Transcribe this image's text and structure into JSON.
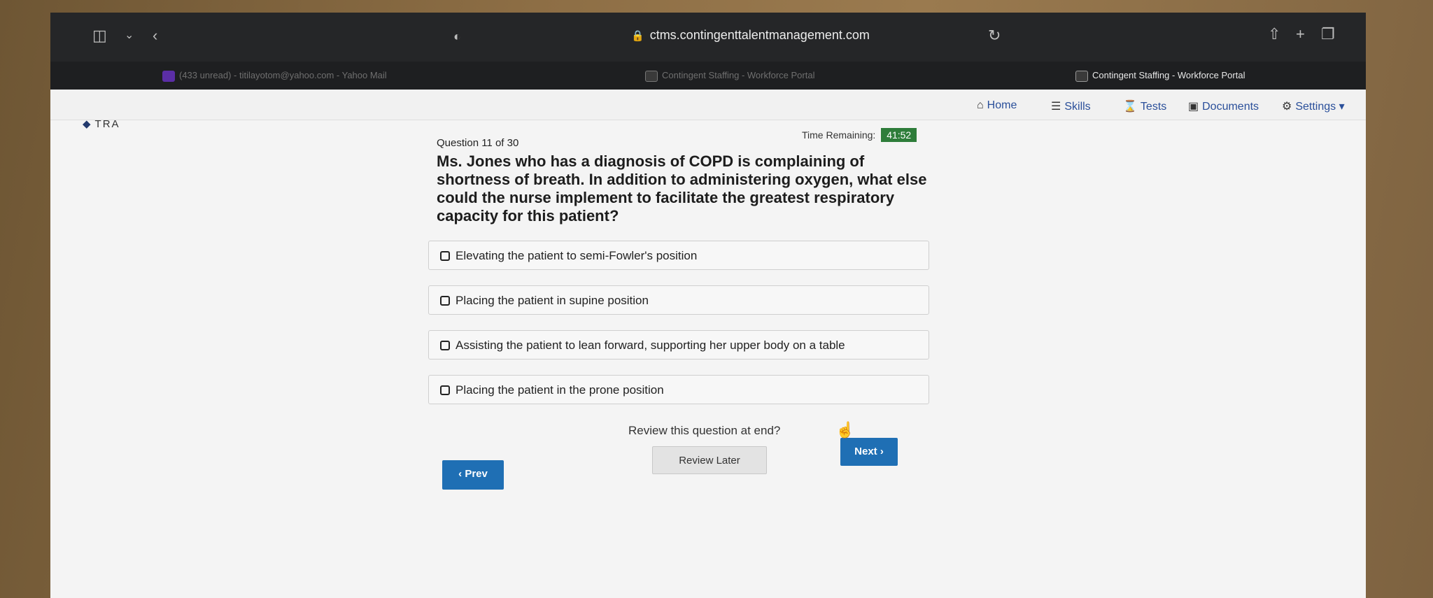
{
  "browser": {
    "url": "ctms.contingenttalentmanagement.com",
    "tabs": [
      {
        "label": "(433 unread) - titilayotom@yahoo.com - Yahoo Mail",
        "active": false
      },
      {
        "label": "Contingent Staffing - Workforce Portal",
        "active": false
      },
      {
        "label": "Contingent Staffing - Workforce Portal",
        "active": true
      }
    ]
  },
  "nav": {
    "home": "Home",
    "skills": "Skills",
    "tests": "Tests",
    "documents": "Documents",
    "settings": "Settings"
  },
  "logo": {
    "text": "TRA"
  },
  "quiz": {
    "question_number": "Question 11 of 30",
    "time_label": "Time Remaining:",
    "time_value": "41:52",
    "question": "Ms. Jones who has a diagnosis of COPD is complaining of shortness of breath. In addition to administering oxygen, what else could the nurse implement to facilitate the greatest respiratory capacity for this patient?",
    "options": [
      "Elevating the patient to semi-Fowler's position",
      "Placing the patient in supine position",
      "Assisting the patient to lean forward, supporting her upper body on a table",
      "Placing the patient in the prone position"
    ],
    "review_prompt": "Review this question at end?",
    "review_button": "Review Later",
    "prev_button": "Prev",
    "next_button": "Next"
  },
  "colors": {
    "accent": "#1f6fb4",
    "timer_badge": "#2e7d3a"
  }
}
